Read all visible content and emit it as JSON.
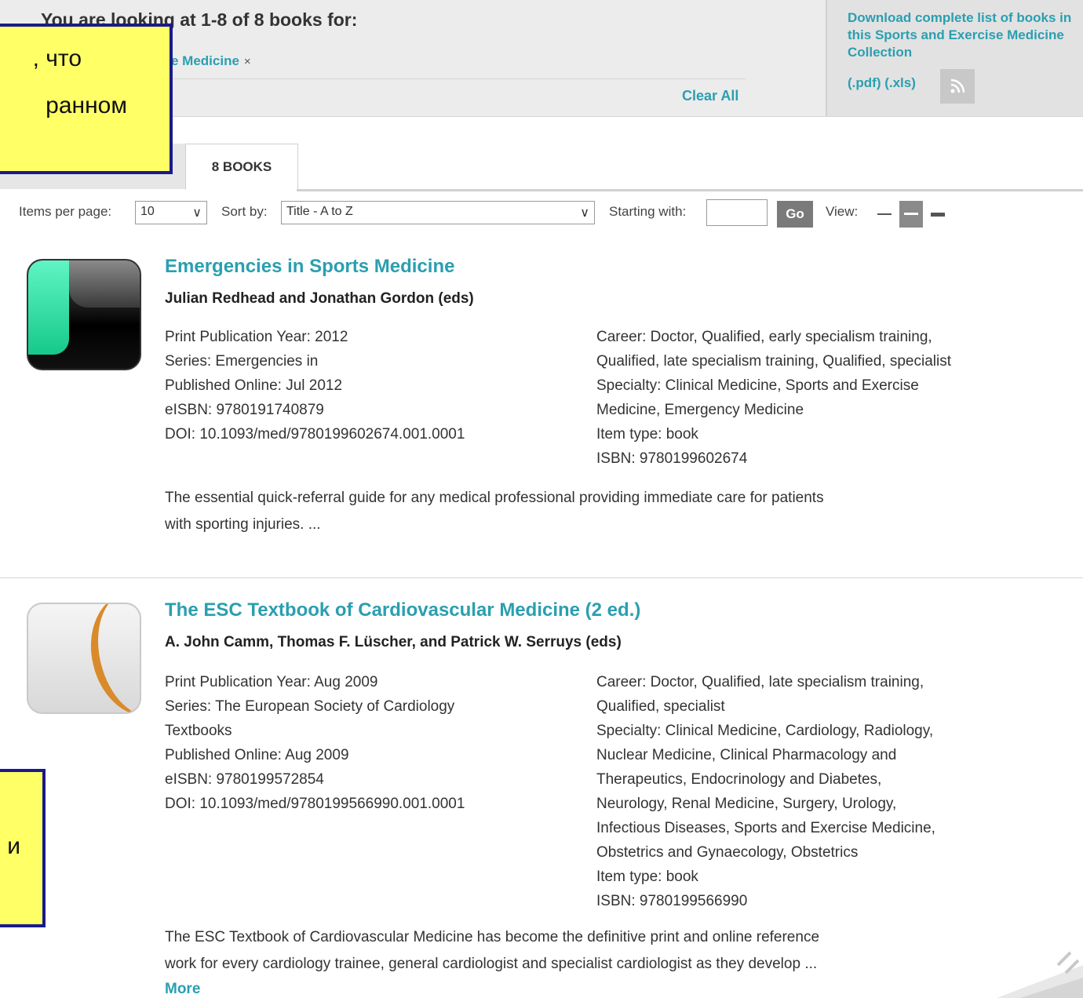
{
  "header": {
    "looking_text": "You are looking at 1-8 of 8 books for:",
    "facet_label": "e Medicine",
    "facet_remove": "×",
    "clear_all": "Clear All",
    "download_text": "Download complete list of books in this Sports and Exercise Medicine Collection",
    "pdf_link": "(.pdf)",
    "xls_link": "(.xls)"
  },
  "tabs": {
    "active_label": "8 BOOKS"
  },
  "toolbar": {
    "items_per_page_label": "Items per page:",
    "items_per_page_value": "10",
    "sort_label": "Sort by:",
    "sort_value": "Title - A to Z",
    "starting_label": "Starting with:",
    "starting_value": "",
    "go_label": "Go",
    "view_label": "View:"
  },
  "results": [
    {
      "title": "Emergencies in Sports Medicine",
      "authors": "Julian Redhead and Jonathan Gordon (eds)",
      "left_meta": [
        "Print Publication Year:  2012",
        "Series: Emergencies in",
        "Published Online: Jul 2012",
        "eISBN: 9780191740879",
        "DOI: 10.1093/med/9780199602674.001.0001"
      ],
      "right_meta": [
        "Career: Doctor, Qualified, early specialism training,",
        "Qualified, late specialism training, Qualified, specialist",
        "Specialty: Clinical Medicine, Sports and Exercise",
        "Medicine, Emergency Medicine",
        "Item type: book",
        "ISBN: 9780199602674"
      ],
      "abstract_1": "The essential quick-referral guide for any medical professional providing immediate care for patients",
      "abstract_2": "with sporting injuries. ..."
    },
    {
      "title": "The ESC Textbook of Cardiovascular Medicine (2 ed.)",
      "authors": "A. John Camm, Thomas F. Lüscher, and Patrick W. Serruys (eds)",
      "left_meta": [
        "Print Publication Year: Aug 2009",
        "Series: The European Society of Cardiology",
        "Textbooks",
        "Published Online: Aug 2009",
        "eISBN: 9780199572854",
        "DOI: 10.1093/med/9780199566990.001.0001"
      ],
      "right_meta": [
        "Career: Doctor, Qualified, late specialism training,",
        "Qualified, specialist",
        "Specialty: Clinical Medicine, Cardiology, Radiology,",
        "Nuclear Medicine, Clinical Pharmacology and",
        "Therapeutics, Endocrinology and Diabetes,",
        "Neurology, Renal Medicine, Surgery, Urology,",
        "Infectious Diseases, Sports and Exercise Medicine,",
        "Obstetrics and Gynaecology, Obstetrics",
        "Item type: book",
        "ISBN: 9780199566990"
      ],
      "abstract_1": "The ESC Textbook of Cardiovascular Medicine has become the definitive print and online reference",
      "abstract_2": "work for every cardiology trainee, general cardiologist and specialist cardiologist as they develop ...",
      "more": "More"
    }
  ],
  "overlays": {
    "callout1_line1": ", что",
    "callout1_line2": "ранном",
    "callout2_line1": "и"
  },
  "colors": {
    "link": "#2a9fb0",
    "callout_bg": "#ffff66",
    "callout_border": "#1a1a8c"
  }
}
